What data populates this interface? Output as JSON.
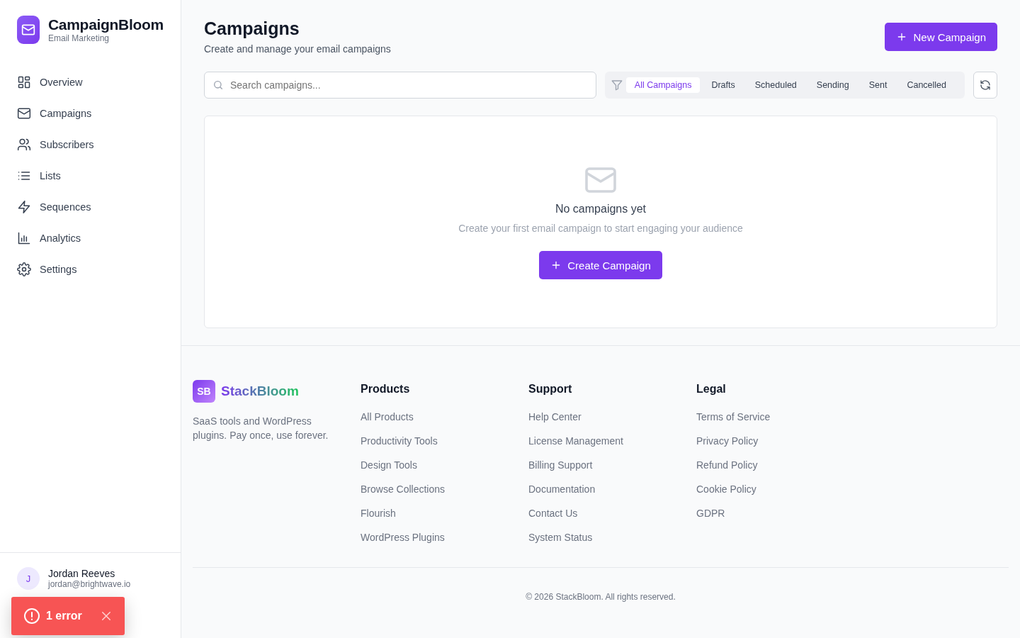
{
  "sidebar": {
    "brand": {
      "name": "CampaignBloom",
      "tagline": "Email Marketing"
    },
    "items": [
      {
        "label": "Overview"
      },
      {
        "label": "Campaigns"
      },
      {
        "label": "Subscribers"
      },
      {
        "label": "Lists"
      },
      {
        "label": "Sequences"
      },
      {
        "label": "Analytics"
      },
      {
        "label": "Settings"
      }
    ],
    "user": {
      "initial": "J",
      "name": "Jordan Reeves",
      "email": "jordan@brightwave.io"
    }
  },
  "header": {
    "title": "Campaigns",
    "subtitle": "Create and manage your email campaigns",
    "new_button": "New Campaign"
  },
  "search": {
    "placeholder": "Search campaigns..."
  },
  "filters": [
    {
      "label": "All Campaigns",
      "selected": true
    },
    {
      "label": "Drafts",
      "selected": false
    },
    {
      "label": "Scheduled",
      "selected": false
    },
    {
      "label": "Sending",
      "selected": false
    },
    {
      "label": "Sent",
      "selected": false
    },
    {
      "label": "Cancelled",
      "selected": false
    }
  ],
  "empty_state": {
    "title": "No campaigns yet",
    "text": "Create your first email campaign to start engaging your audience",
    "button": "Create Campaign"
  },
  "footer": {
    "logo_mark": "SB",
    "logo_name": "StackBloom",
    "description": "SaaS tools and WordPress plugins. Pay once, use forever.",
    "columns": [
      {
        "heading": "Products",
        "links": [
          "All Products",
          "Productivity Tools",
          "Design Tools",
          "Browse Collections",
          "Flourish",
          "WordPress Plugins"
        ]
      },
      {
        "heading": "Support",
        "links": [
          "Help Center",
          "License Management",
          "Billing Support",
          "Documentation",
          "Contact Us",
          "System Status"
        ]
      },
      {
        "heading": "Legal",
        "links": [
          "Terms of Service",
          "Privacy Policy",
          "Refund Policy",
          "Cookie Policy",
          "GDPR"
        ]
      }
    ],
    "copyright": "© 2026 StackBloom. All rights reserved."
  },
  "toast": {
    "message": "1 error"
  }
}
